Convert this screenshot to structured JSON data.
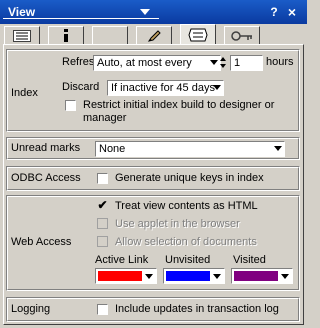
{
  "window": {
    "title": "View",
    "help_label": "?",
    "close_label": "×"
  },
  "tabs": [
    {
      "icon": "list-icon"
    },
    {
      "icon": "info-icon"
    },
    {
      "icon": "blank-icon"
    },
    {
      "icon": "pen-icon"
    },
    {
      "icon": "sheet-icon"
    },
    {
      "icon": "key-icon"
    }
  ],
  "index": {
    "label": "Index",
    "refresh_label": "Refresh",
    "refresh_value": "Auto, at most every",
    "hours_value": "1",
    "hours_label": "hours",
    "discard_label": "Discard",
    "discard_value": "If inactive for 45 days",
    "restrict_label": "Restrict initial index build to designer or",
    "restrict_label_line2": "manager",
    "restrict_checked": false
  },
  "unread": {
    "label": "Unread marks",
    "value": "None"
  },
  "odbc": {
    "label": "ODBC Access",
    "generate_label": "Generate unique keys in index",
    "generate_checked": false
  },
  "web": {
    "label": "Web Access",
    "treat_label": "Treat view contents as HTML",
    "treat_checked": true,
    "applet_label": "Use applet in the browser",
    "allow_label": "Allow selection of documents",
    "active_link_label": "Active Link",
    "unvisited_label": "Unvisited",
    "visited_label": "Visited",
    "active_link_color": "#ff0000",
    "unvisited_color": "#0000ff",
    "visited_color": "#800080"
  },
  "logging": {
    "label": "Logging",
    "include_label": "Include updates in transaction log",
    "include_checked": false
  }
}
